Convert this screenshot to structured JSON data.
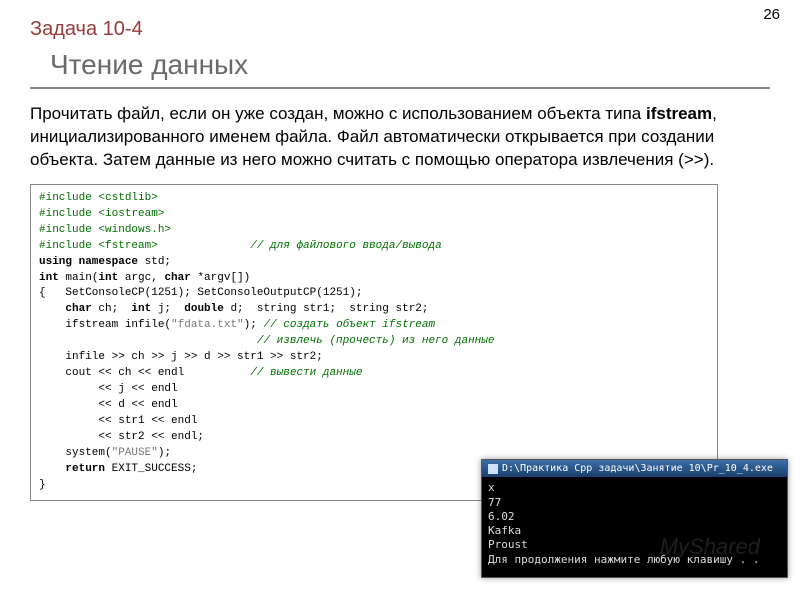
{
  "page_number": "26",
  "task_label": "Задача 10-4",
  "title": "Чтение данных",
  "body_html": "Прочитать файл, если он уже создан, можно с использованием объекта типа <b>ifstream</b>, инициализированного именем файла. Файл автоматически открывается при создании объекта. Затем данные из него можно считать с помощью оператора извлечения (>>).",
  "code": {
    "lines": [
      {
        "type": "pp",
        "text": "#include <cstdlib>"
      },
      {
        "type": "pp",
        "text": "#include <iostream>"
      },
      {
        "type": "pp",
        "text": "#include <windows.h>"
      },
      {
        "type": "pp2",
        "text": "#include <fstream>",
        "comment": "// для файлового ввода/вывода"
      },
      {
        "type": "plain",
        "html": "<span class='kw'>using namespace</span> std;"
      },
      {
        "type": "plain",
        "html": "<span class='kw'>int</span> main(<span class='kw'>int</span> argc, <span class='kw'>char</span> *argv[])"
      },
      {
        "type": "plain",
        "html": "{   SetConsoleCP(1251); SetConsoleOutputCP(1251);"
      },
      {
        "type": "plain",
        "html": "    <span class='kw'>char</span> ch;  <span class='kw'>int</span> j;  <span class='kw'>double</span> d;  string str1;  string str2;"
      },
      {
        "type": "plain",
        "html": "    ifstream infile(<span class='str'>\"fdata.txt\"</span>); <span class='cmt'>// создать объект ifstream</span>"
      },
      {
        "type": "plain",
        "html": "                                 <span class='cmt'>// извлечь (прочесть) из него данные</span>"
      },
      {
        "type": "plain",
        "html": "    infile >> ch >> j >> d >> str1 >> str2;"
      },
      {
        "type": "plain",
        "html": "    cout &lt;&lt; ch &lt;&lt; endl          <span class='cmt'>// вывести данные</span>"
      },
      {
        "type": "plain",
        "html": "         &lt;&lt; j &lt;&lt; endl"
      },
      {
        "type": "plain",
        "html": "         &lt;&lt; d &lt;&lt; endl"
      },
      {
        "type": "plain",
        "html": "         &lt;&lt; str1 &lt;&lt; endl"
      },
      {
        "type": "plain",
        "html": "         &lt;&lt; str2 &lt;&lt; endl;"
      },
      {
        "type": "plain",
        "html": "    system(<span class='str'>\"PAUSE\"</span>);"
      },
      {
        "type": "plain",
        "html": "    <span class='kw'>return</span> EXIT_SUCCESS;"
      },
      {
        "type": "plain",
        "html": "}"
      }
    ]
  },
  "console": {
    "title": "D:\\Практика Cpp задачи\\Занятие 10\\Pr_10_4.exe",
    "output": "x\n77\n6.02\nKafka\nProust\nДля продолжения нажмите любую клавишу . ."
  },
  "watermark": "MyShared"
}
